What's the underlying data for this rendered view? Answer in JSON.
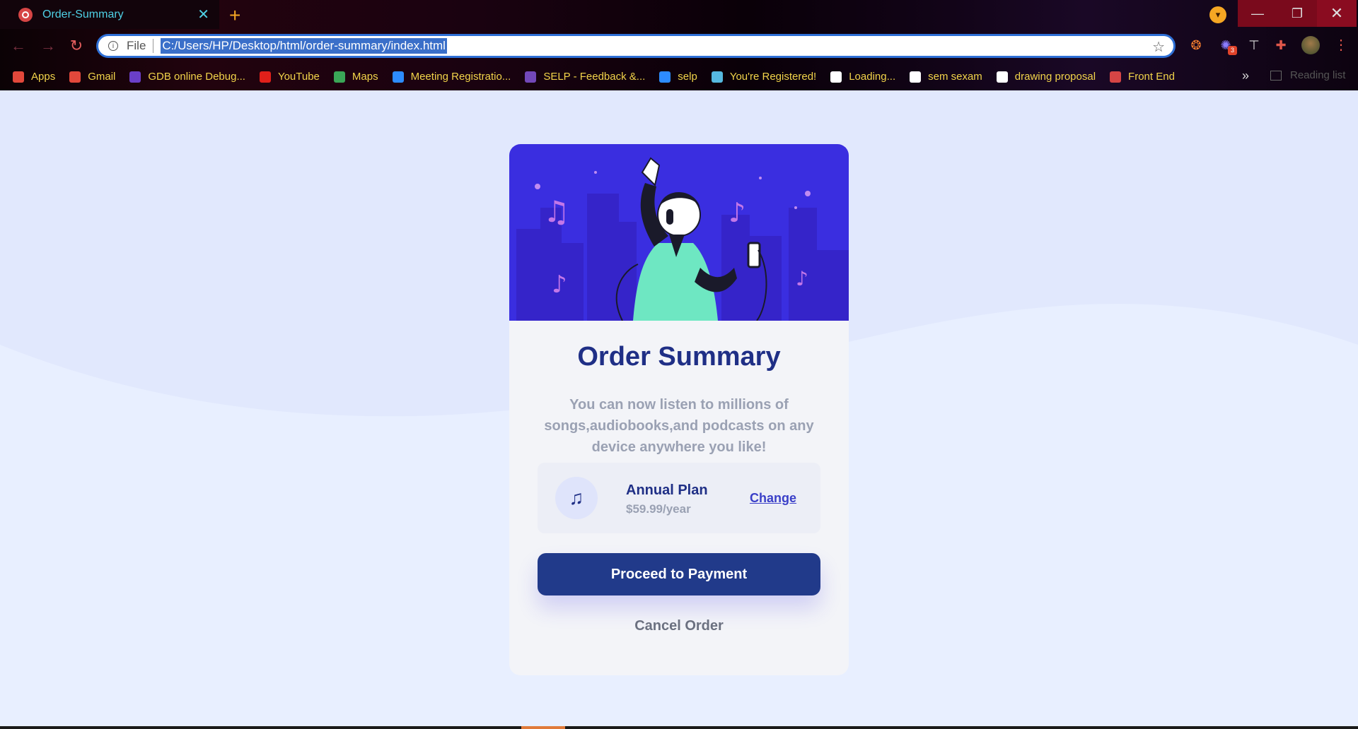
{
  "browser": {
    "tab_title": "Order-Summary",
    "tab_close": "✕",
    "new_tab": "+",
    "profile_badge": "▾",
    "window": {
      "minimize": "—",
      "maximize": "❐",
      "close": "✕"
    },
    "nav": {
      "back": "←",
      "forward": "→",
      "reload": "↻"
    },
    "omnibox": {
      "info": "i",
      "scheme": "File",
      "url": "C:/Users/HP/Desktop/html/order-summary/index.html",
      "star": "☆"
    },
    "extensions": [
      {
        "name": "extension-flame-icon",
        "glyph": "❂"
      },
      {
        "name": "extension-badge-icon",
        "glyph": "✺",
        "badge": "3"
      },
      {
        "name": "extension-hammer-icon",
        "glyph": "⊤"
      },
      {
        "name": "extensions-puzzle-icon",
        "glyph": "✚"
      }
    ],
    "menu": "⋮",
    "bookmarks": [
      {
        "label": "Apps",
        "icon": "apps-grid-icon",
        "color": "#e2483b"
      },
      {
        "label": "Gmail",
        "icon": "gmail-icon",
        "color": "#e2483b"
      },
      {
        "label": "GDB online Debug...",
        "icon": "gdb-icon",
        "color": "#6a3fc8"
      },
      {
        "label": "YouTube",
        "icon": "youtube-icon",
        "color": "#e0201a"
      },
      {
        "label": "Maps",
        "icon": "maps-icon",
        "color": "#3aa757"
      },
      {
        "label": "Meeting Registratio...",
        "icon": "zoom-icon",
        "color": "#2d8cff"
      },
      {
        "label": "SELP - Feedback &...",
        "icon": "forms-icon",
        "color": "#7248b9"
      },
      {
        "label": "selp",
        "icon": "zoom-icon",
        "color": "#2d8cff"
      },
      {
        "label": "You're Registered!",
        "icon": "registered-icon",
        "color": "#56b9e0"
      },
      {
        "label": "Loading...",
        "icon": "page-icon",
        "color": "#ffffff"
      },
      {
        "label": "sem sexam",
        "icon": "exam-icon",
        "color": "#ffffff"
      },
      {
        "label": "drawing proposal",
        "icon": "doc-icon",
        "color": "#ffffff"
      },
      {
        "label": "Front End",
        "icon": "globe-icon",
        "color": "#d64545"
      }
    ],
    "bookmarks_more": "»",
    "reading_list": "Reading list"
  },
  "card": {
    "title": "Order Summary",
    "description": "You can now listen to millions of songs,audiobooks,and podcasts on any device anywhere you like!",
    "plan": {
      "icon": "♫",
      "name": "Annual Plan",
      "price": "$59.99/year",
      "change_label": "Change"
    },
    "proceed_label": "Proceed to Payment",
    "cancel_label": "Cancel Order"
  },
  "colors": {
    "accent": "#213a8a",
    "hero": "#3a2ee0",
    "page_bg": "#e1e8fd"
  }
}
